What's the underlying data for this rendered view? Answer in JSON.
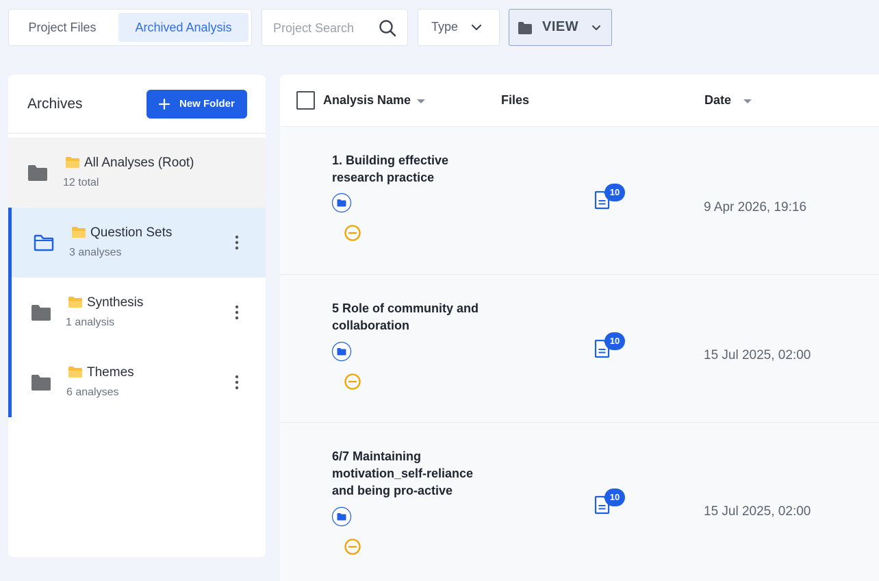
{
  "tabs": [
    {
      "label": "Project Files",
      "active": false
    },
    {
      "label": "Archived Analysis",
      "active": true
    }
  ],
  "search": {
    "placeholder": "Project Search"
  },
  "type_filter": {
    "label": "Type"
  },
  "view_button": {
    "label": "VIEW"
  },
  "sidebar": {
    "title": "Archives",
    "new_folder_label": "New Folder",
    "folders": [
      {
        "name": "All Analyses (Root)",
        "count": "12 total",
        "selected": false
      },
      {
        "name": "Question Sets",
        "count": "3 analyses",
        "selected": true
      },
      {
        "name": "Synthesis",
        "count": "1 analysis",
        "selected": false
      },
      {
        "name": "Themes",
        "count": "6 analyses",
        "selected": false
      }
    ]
  },
  "table": {
    "columns": {
      "name": "Analysis Name",
      "files": "Files",
      "date": "Date"
    },
    "rows": [
      {
        "name": "1. Building effective research practice",
        "files": "10",
        "date": "9 Apr 2026, 19:16"
      },
      {
        "name": "5 Role of community and collaboration",
        "files": "10",
        "date": "15 Jul 2025, 02:00"
      },
      {
        "name": "6/7 Maintaining motivation_self-reliance and being pro-active",
        "files": "10",
        "date": "15 Jul 2025, 02:00"
      }
    ]
  },
  "colors": {
    "accent": "#1f5fe6",
    "folder_yellow": "#f9bf3b",
    "status_orange": "#f5a100",
    "selected_bg": "#e3f0fb"
  }
}
